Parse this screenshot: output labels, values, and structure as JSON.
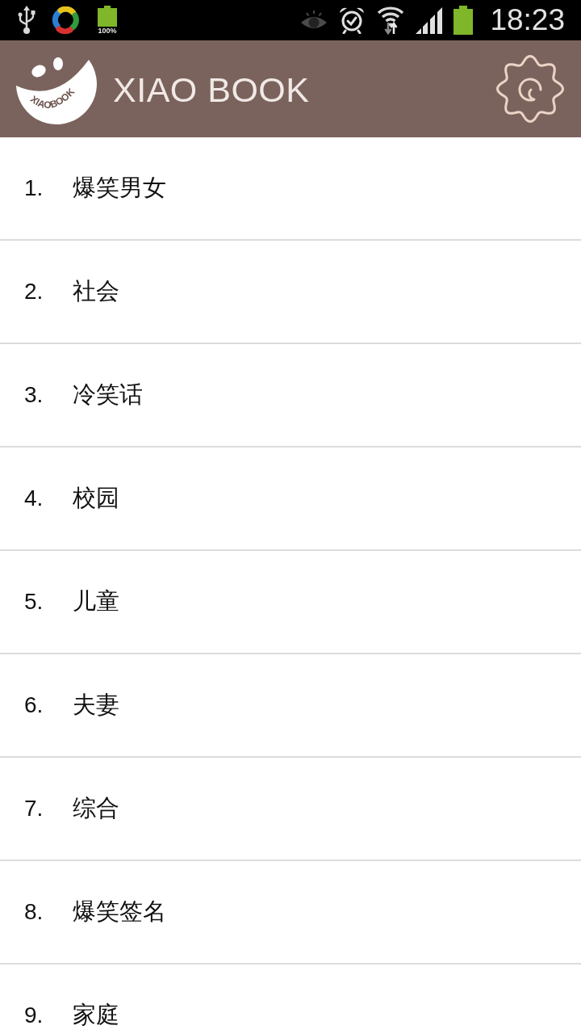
{
  "status_bar": {
    "battery_notification_label": "100%",
    "time": "18:23"
  },
  "app_bar": {
    "logo_text": "XIAOBOOK",
    "title": "XIAO BOOK"
  },
  "categories": [
    {
      "number": "1.",
      "name": "爆笑男女"
    },
    {
      "number": "2.",
      "name": "社会"
    },
    {
      "number": "3.",
      "name": "冷笑话"
    },
    {
      "number": "4.",
      "name": "校园"
    },
    {
      "number": "5.",
      "name": "儿童"
    },
    {
      "number": "6.",
      "name": "夫妻"
    },
    {
      "number": "7.",
      "name": "综合"
    },
    {
      "number": "8.",
      "name": "爆笑签名"
    },
    {
      "number": "9.",
      "name": "家庭"
    }
  ]
}
